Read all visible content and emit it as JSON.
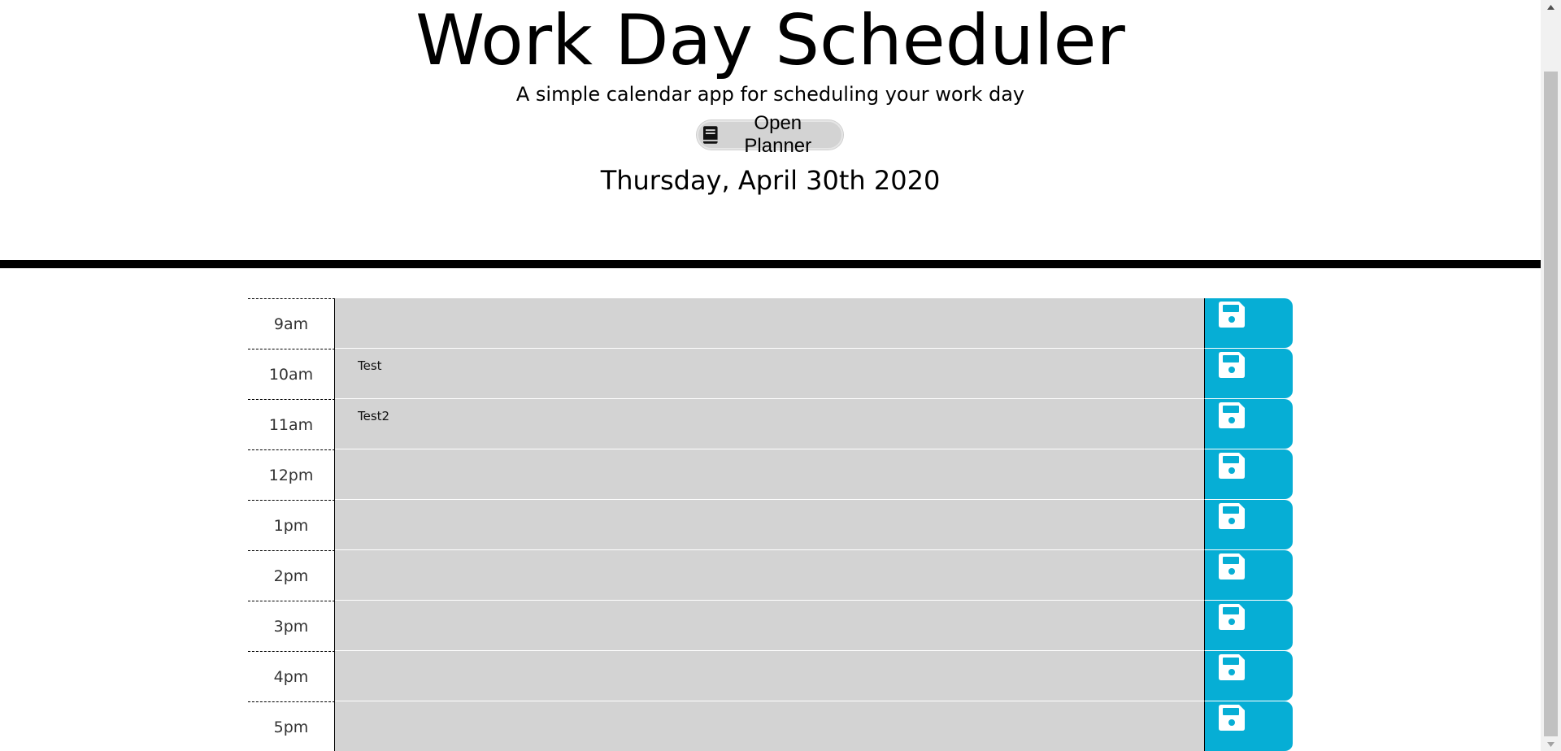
{
  "header": {
    "title": "Work Day Scheduler",
    "subtitle": "A simple calendar app for scheduling your work day",
    "planner_button_label": "Open Planner",
    "current_day": "Thursday, April 30th 2020"
  },
  "colors": {
    "description_bg": "#d3d3d3",
    "save_button": "#06aed5",
    "divider": "#000000"
  },
  "icons": {
    "planner_button": "book-icon",
    "save_button": "floppy-disk-icon"
  },
  "schedule": {
    "rows": [
      {
        "hour": "9am",
        "text": ""
      },
      {
        "hour": "10am",
        "text": "Test"
      },
      {
        "hour": "11am",
        "text": "Test2"
      },
      {
        "hour": "12pm",
        "text": ""
      },
      {
        "hour": "1pm",
        "text": ""
      },
      {
        "hour": "2pm",
        "text": ""
      },
      {
        "hour": "3pm",
        "text": ""
      },
      {
        "hour": "4pm",
        "text": ""
      },
      {
        "hour": "5pm",
        "text": ""
      }
    ]
  }
}
